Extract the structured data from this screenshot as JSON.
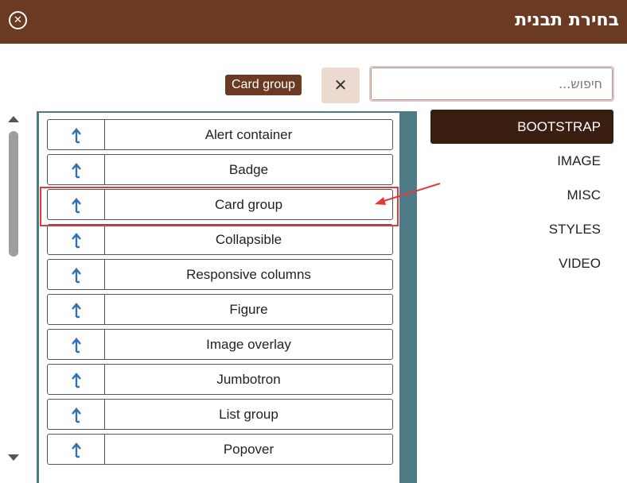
{
  "dialog": {
    "title": "בחירת תבנית",
    "close_glyph": "✕"
  },
  "search": {
    "placeholder": "חיפוש...",
    "value": "",
    "clear_glyph": "✕",
    "selected_chip": "Card group"
  },
  "categories": [
    "BOOTSTRAP",
    "IMAGE",
    "MISC",
    "STYLES",
    "VIDEO"
  ],
  "active_category": "BOOTSTRAP",
  "templates": [
    "Alert container",
    "Badge",
    "Card group",
    "Collapsible",
    "Responsive columns",
    "Figure",
    "Image overlay",
    "Jumbotron",
    "List group",
    "Popover"
  ],
  "highlighted_template": "Card group",
  "colors": {
    "header": "#6b3a22",
    "active_category": "#3b1e12",
    "panel_border": "#4f7b87",
    "insert_icon": "#2f6fb5",
    "annotation": "#e53935"
  },
  "icons": {
    "row_icon": "insert-template-icon",
    "close": "close-circle-icon"
  }
}
